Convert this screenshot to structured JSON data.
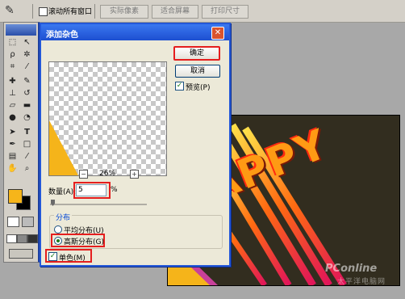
{
  "options_bar": {
    "all_windows_label": "滚动所有窗口",
    "actual_pixels_label": "实际像素",
    "fit_screen_label": "适合屏幕",
    "print_size_label": "打印尺寸"
  },
  "dialog": {
    "title": "添加杂色",
    "ok_label": "确定",
    "cancel_label": "取消",
    "preview_label": "预览(P)",
    "preview_checked": true,
    "zoom_value": "26%",
    "amount_label": "数量(A):",
    "amount_value": "5",
    "amount_unit": "%",
    "distribution_label": "分布",
    "uniform_label": "平均分布(U)",
    "gaussian_label": "高斯分布(G)",
    "selected_distribution": "gaussian",
    "monochromatic_label": "单色(M)",
    "monochromatic_checked": true
  },
  "canvas_text": "APPY",
  "watermark": {
    "brand": "PConline",
    "tagline": "太平洋电脑网"
  },
  "colors": {
    "foreground": "#f6b51a",
    "background": "#000000",
    "titlebar": "#1d4fd0",
    "canvas_bg": "#322d1f",
    "highlight_red": "#e51e1e"
  }
}
